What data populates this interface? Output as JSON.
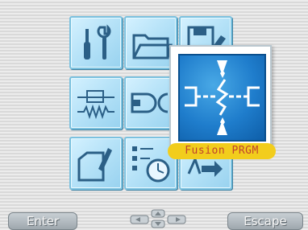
{
  "menu": {
    "selected_label": "Fusion PRGM",
    "items": [
      {
        "icon": "tools-icon"
      },
      {
        "icon": "folder-icon"
      },
      {
        "icon": "save-edit-icon"
      },
      {
        "icon": "resistor-icon"
      },
      {
        "icon": "connector-icon"
      },
      {
        "icon": "fusion-icon"
      },
      {
        "icon": "notepad-pen-icon"
      },
      {
        "icon": "schedule-icon"
      },
      {
        "icon": "splice-arrow-icon"
      }
    ]
  },
  "softkeys": {
    "left_label": "Enter",
    "right_label": "Escape"
  },
  "colors": {
    "tile_bg": "#b7e3f8",
    "selected_bg": "#1f7dcc",
    "label_bg": "#f2cd1c",
    "label_text": "#c0432e"
  }
}
